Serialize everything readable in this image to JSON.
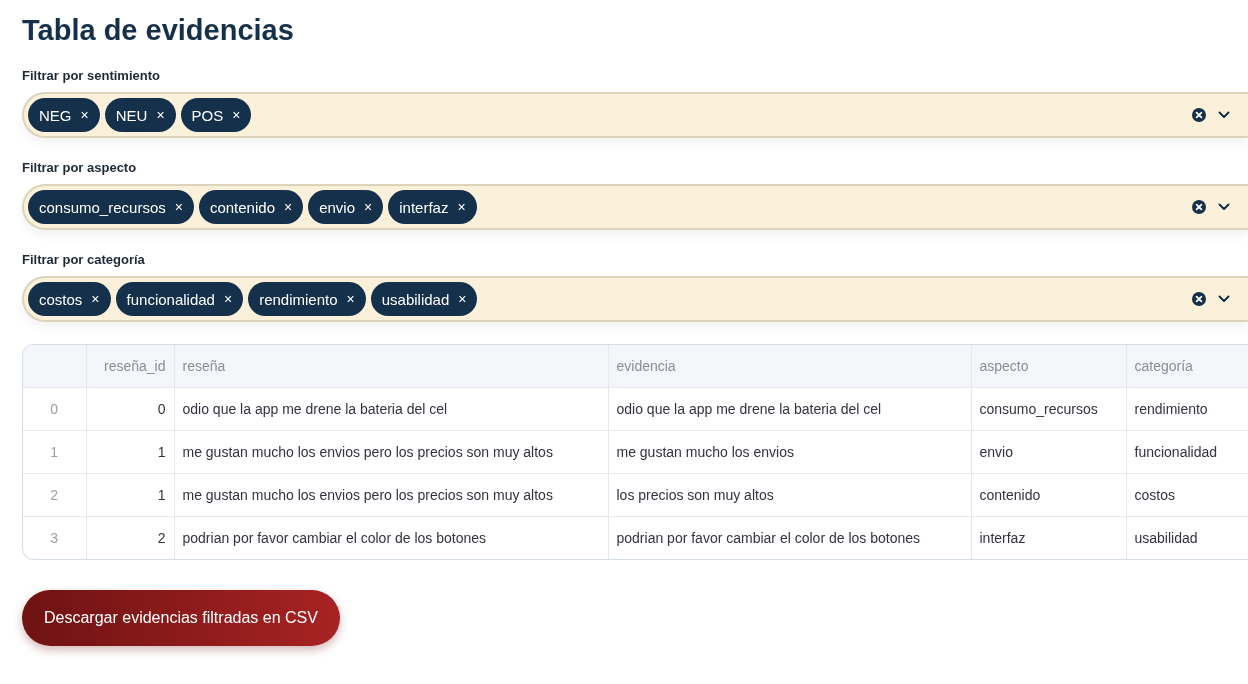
{
  "title": "Tabla de evidencias",
  "filters": [
    {
      "label": "Filtrar por sentimiento",
      "chips": [
        {
          "text": "NEG",
          "remove": "×"
        },
        {
          "text": "NEU",
          "remove": "×"
        },
        {
          "text": "POS",
          "remove": "×"
        }
      ]
    },
    {
      "label": "Filtrar por aspecto",
      "chips": [
        {
          "text": "consumo_recursos",
          "remove": "×"
        },
        {
          "text": "contenido",
          "remove": "×"
        },
        {
          "text": "envio",
          "remove": "×"
        },
        {
          "text": "interfaz",
          "remove": "×"
        }
      ]
    },
    {
      "label": "Filtrar por categoría",
      "chips": [
        {
          "text": "costos",
          "remove": "×"
        },
        {
          "text": "funcionalidad",
          "remove": "×"
        },
        {
          "text": "rendimiento",
          "remove": "×"
        },
        {
          "text": "usabilidad",
          "remove": "×"
        }
      ]
    }
  ],
  "table": {
    "columns": [
      "",
      "reseña_id",
      "reseña",
      "evidencia",
      "aspecto",
      "categoría"
    ],
    "rows": [
      [
        "0",
        "0",
        "odio que la app me drene la bateria del cel",
        "odio que la app me drene la bateria del cel",
        "consumo_recursos",
        "rendimiento"
      ],
      [
        "1",
        "1",
        "me gustan mucho los envios pero los precios son muy altos",
        "me gustan mucho los envios",
        "envio",
        "funcionalidad"
      ],
      [
        "2",
        "1",
        "me gustan mucho los envios pero los precios son muy altos",
        "los precios son muy altos",
        "contenido",
        "costos"
      ],
      [
        "3",
        "2",
        "podrian por favor cambiar el color de los botones",
        "podrian por favor cambiar el color de los botones",
        "interfaz",
        "usabilidad"
      ]
    ]
  },
  "download_button": "Descargar evidencias filtradas en CSV"
}
